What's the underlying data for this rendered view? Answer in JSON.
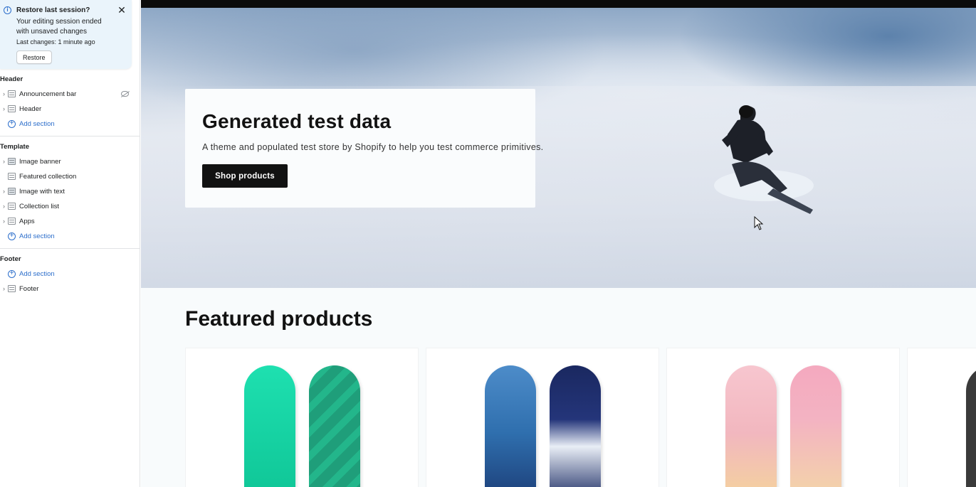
{
  "restore_banner": {
    "title": "Restore last session?",
    "message": "Your editing session ended with unsaved changes",
    "last_changes": "Last changes: 1 minute ago",
    "restore_label": "Restore",
    "close_glyph": "✕"
  },
  "sidebar": {
    "header_group": {
      "title": "Header",
      "items": [
        {
          "label": "Announcement bar",
          "icon": "section-icon",
          "hidden": true
        },
        {
          "label": "Header",
          "icon": "section-icon"
        }
      ],
      "add_label": "Add section"
    },
    "template_group": {
      "title": "Template",
      "items": [
        {
          "label": "Image banner",
          "icon": "image-section-icon"
        },
        {
          "label": "Featured collection",
          "icon": "section-icon"
        },
        {
          "label": "Image with text",
          "icon": "image-section-icon"
        },
        {
          "label": "Collection list",
          "icon": "section-icon"
        },
        {
          "label": "Apps",
          "icon": "section-icon"
        }
      ],
      "add_label": "Add section"
    },
    "footer_group": {
      "title": "Footer",
      "add_label": "Add section",
      "items": [
        {
          "label": "Footer",
          "icon": "section-icon"
        }
      ]
    }
  },
  "preview": {
    "hero": {
      "title": "Generated test data",
      "subtitle": "A theme and populated test store by Shopify to help you test commerce primitives.",
      "button_label": "Shop products"
    },
    "featured": {
      "title": "Featured products",
      "products": [
        {
          "colors": [
            "#16d3a3",
            "#1f9e7a"
          ]
        },
        {
          "colors": [
            "#3a78b8",
            "#1b2b63"
          ]
        },
        {
          "colors": [
            "#f2b9c6",
            "#f6c2cf"
          ]
        }
      ]
    }
  },
  "colors": {
    "accent": "#2c6ecb",
    "banner_bg": "#eaf4fb",
    "button_dark": "#121212"
  }
}
